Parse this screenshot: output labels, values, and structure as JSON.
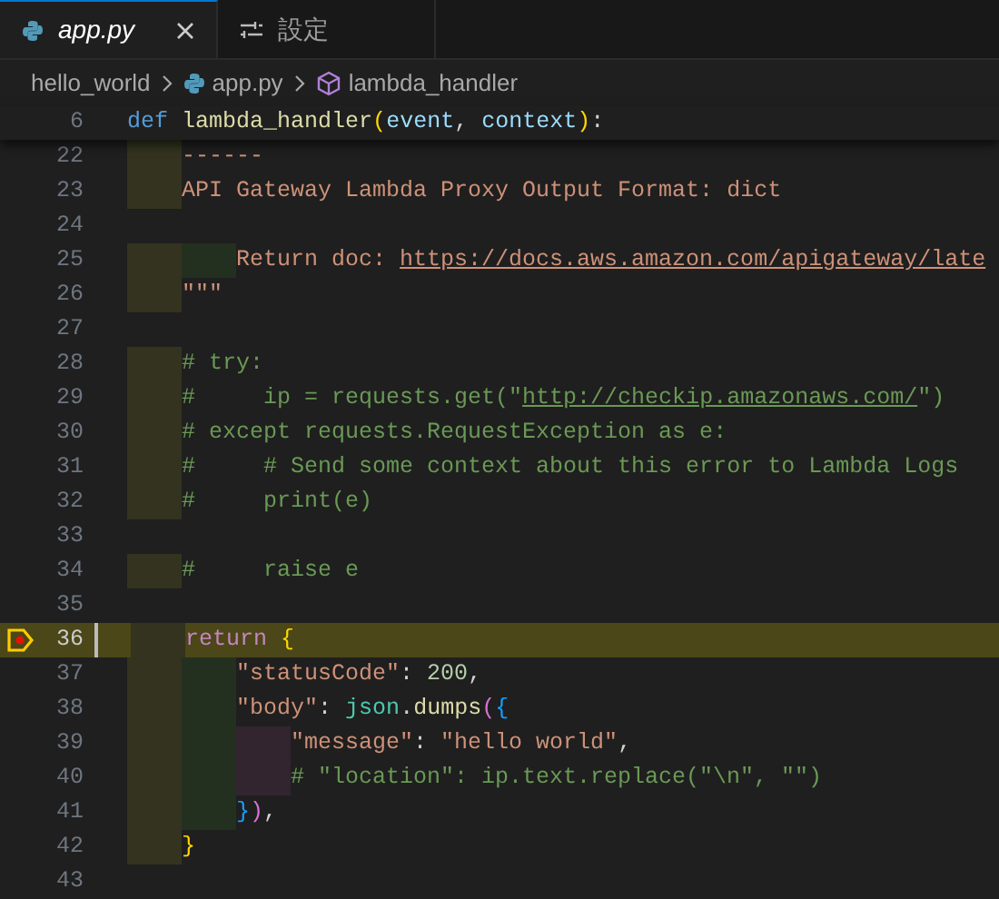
{
  "tabs": [
    {
      "label": "app.py",
      "kind": "python",
      "selected": true,
      "preview": true
    },
    {
      "label": "設定",
      "kind": "settings",
      "selected": false,
      "preview": false
    }
  ],
  "breadcrumb": [
    {
      "label": "hello_world",
      "kind": "folder"
    },
    {
      "label": "app.py",
      "kind": "python"
    },
    {
      "label": "lambda_handler",
      "kind": "symbol"
    }
  ],
  "sticky_line": {
    "number": "6",
    "tokens": [
      {
        "text": "def ",
        "kind": "keyword"
      },
      {
        "text": "lambda_handler",
        "kind": "function"
      },
      {
        "text": "(",
        "kind": "bracket1"
      },
      {
        "text": "event",
        "kind": "param"
      },
      {
        "text": ", ",
        "kind": "plain"
      },
      {
        "text": "context",
        "kind": "param"
      },
      {
        "text": ")",
        "kind": "bracket1"
      },
      {
        "text": ":",
        "kind": "plain"
      }
    ]
  },
  "lines": [
    {
      "number": "22",
      "current": false,
      "breakpoint": false,
      "tokens": [
        {
          "text": "    ------",
          "kind": "string"
        }
      ]
    },
    {
      "number": "23",
      "current": false,
      "breakpoint": false,
      "tokens": [
        {
          "text": "    API Gateway Lambda Proxy Output Format: dict",
          "kind": "string"
        }
      ]
    },
    {
      "number": "24",
      "current": false,
      "breakpoint": false
    },
    {
      "number": "25",
      "current": false,
      "breakpoint": false,
      "tokens": [
        {
          "text": "        Return doc: ",
          "kind": "string"
        },
        {
          "text": "https://docs.aws.amazon.com/apigateway/late",
          "kind": "link"
        }
      ]
    },
    {
      "number": "26",
      "current": false,
      "breakpoint": false,
      "tokens": [
        {
          "text": "    \"\"\"",
          "kind": "string"
        }
      ]
    },
    {
      "number": "27",
      "current": false,
      "breakpoint": false
    },
    {
      "number": "28",
      "current": false,
      "breakpoint": false,
      "tokens": [
        {
          "text": "    # try:",
          "kind": "comment"
        }
      ]
    },
    {
      "number": "29",
      "current": false,
      "breakpoint": false,
      "tokens": [
        {
          "text": "    #     ip = requests.get(\"",
          "kind": "comment"
        },
        {
          "text": "http://checkip.amazonaws.com/",
          "kind": "comment-link"
        },
        {
          "text": "\")",
          "kind": "comment"
        }
      ]
    },
    {
      "number": "30",
      "current": false,
      "breakpoint": false,
      "tokens": [
        {
          "text": "    # except requests.RequestException as e:",
          "kind": "comment"
        }
      ]
    },
    {
      "number": "31",
      "current": false,
      "breakpoint": false,
      "tokens": [
        {
          "text": "    #     # Send some context about this error to Lambda Logs",
          "kind": "comment"
        }
      ]
    },
    {
      "number": "32",
      "current": false,
      "breakpoint": false,
      "tokens": [
        {
          "text": "    #     print(e)",
          "kind": "comment"
        }
      ]
    },
    {
      "number": "33",
      "current": false,
      "breakpoint": false
    },
    {
      "number": "34",
      "current": false,
      "breakpoint": false,
      "tokens": [
        {
          "text": "    #     raise e",
          "kind": "comment"
        }
      ]
    },
    {
      "number": "35",
      "current": false,
      "breakpoint": false
    },
    {
      "number": "36",
      "current": true,
      "breakpoint": true,
      "tokens": [
        {
          "text": "    return",
          "kind": "control"
        },
        {
          "text": " {",
          "kind": "bracket1"
        }
      ]
    },
    {
      "number": "37",
      "current": false,
      "breakpoint": false,
      "tokens": [
        {
          "text": "        \"statusCode\"",
          "kind": "string"
        },
        {
          "text": ": ",
          "kind": "plain"
        },
        {
          "text": "200",
          "kind": "number"
        },
        {
          "text": ",",
          "kind": "plain"
        }
      ]
    },
    {
      "number": "38",
      "current": false,
      "breakpoint": false,
      "tokens": [
        {
          "text": "        \"body\"",
          "kind": "string"
        },
        {
          "text": ": ",
          "kind": "plain"
        },
        {
          "text": "json",
          "kind": "class"
        },
        {
          "text": ".",
          "kind": "plain"
        },
        {
          "text": "dumps",
          "kind": "function"
        },
        {
          "text": "(",
          "kind": "bracket2"
        },
        {
          "text": "{",
          "kind": "bracket3"
        }
      ]
    },
    {
      "number": "39",
      "current": false,
      "breakpoint": false,
      "tokens": [
        {
          "text": "            \"message\"",
          "kind": "string"
        },
        {
          "text": ": ",
          "kind": "plain"
        },
        {
          "text": "\"hello world\"",
          "kind": "string"
        },
        {
          "text": ",",
          "kind": "plain"
        }
      ]
    },
    {
      "number": "40",
      "current": false,
      "breakpoint": false,
      "tokens": [
        {
          "text": "            # \"location\": ip.text.replace(\"\\n\", \"\")",
          "kind": "comment"
        }
      ]
    },
    {
      "number": "41",
      "current": false,
      "breakpoint": false,
      "tokens": [
        {
          "text": "        }",
          "kind": "bracket3"
        },
        {
          "text": ")",
          "kind": "bracket2"
        },
        {
          "text": ",",
          "kind": "plain"
        }
      ]
    },
    {
      "number": "42",
      "current": false,
      "breakpoint": false,
      "tokens": [
        {
          "text": "    }",
          "kind": "bracket1"
        }
      ]
    },
    {
      "number": "43",
      "current": false,
      "breakpoint": false
    }
  ]
}
